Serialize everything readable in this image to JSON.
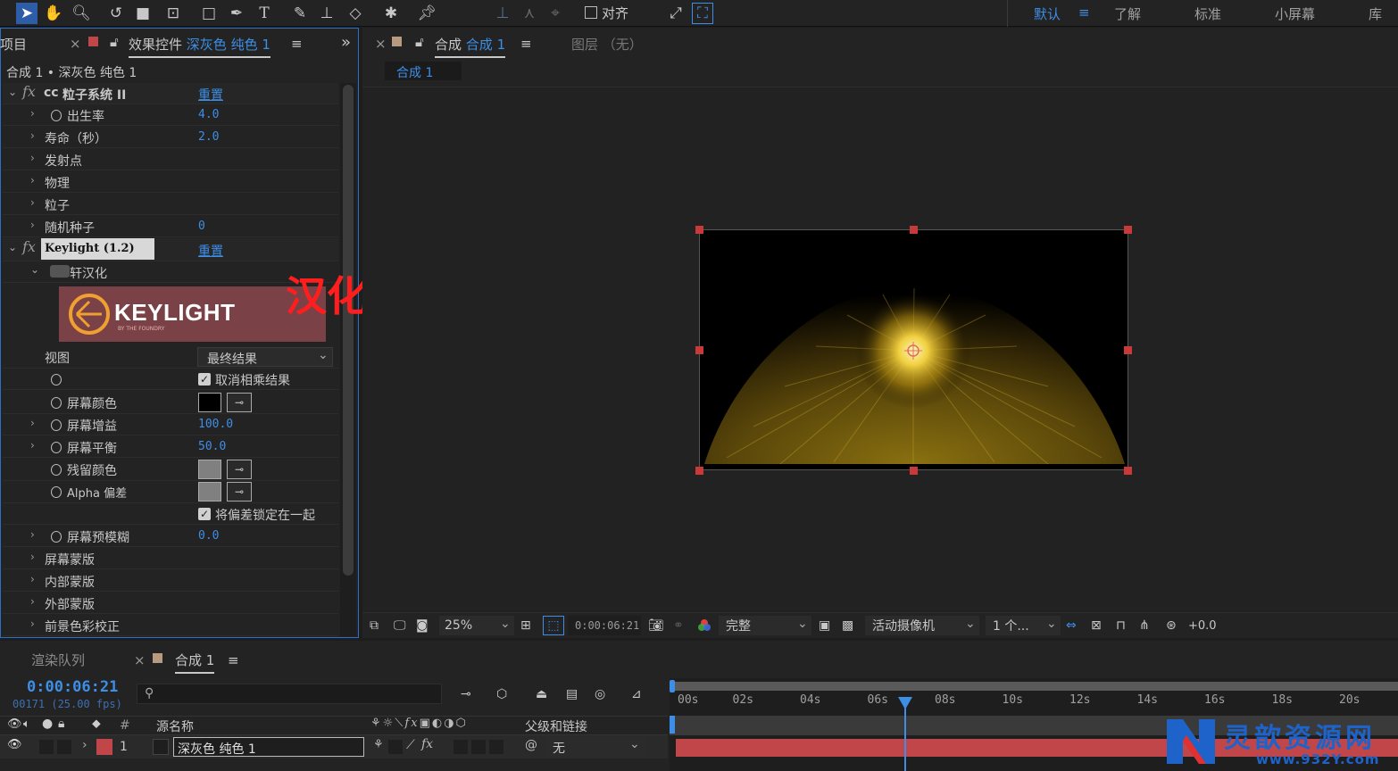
{
  "toolbar": {
    "align_label": "对齐",
    "workspaces": [
      "默认",
      "了解",
      "标准",
      "小屏幕",
      "库"
    ]
  },
  "effects_panel": {
    "project_tab": "项目",
    "tab_title": "效果控件",
    "tab_layer": "深灰色 纯色 1",
    "breadcrumb": "合成 1 • 深灰色 纯色 1",
    "effect1": {
      "name": "粒子系统 II",
      "reset": "重置"
    },
    "rows1": [
      {
        "label": "出生率",
        "value": "4.0"
      },
      {
        "label": "寿命（秒）",
        "value": "2.0"
      },
      {
        "label": "发射点",
        "value": ""
      },
      {
        "label": "物理",
        "value": ""
      },
      {
        "label": "粒子",
        "value": ""
      },
      {
        "label": "随机种子",
        "value": "0"
      }
    ],
    "effect2": {
      "name": "Keylight (1.2)",
      "reset": "重置"
    },
    "localized_group": "轩汉化",
    "logo_text": "KEYLIGHT",
    "logo_sub": "BY THE FOUNDRY",
    "overlay_text": "汉化后",
    "view_label": "视图",
    "view_value": "最终结果",
    "unpremultiply": "取消相乘结果",
    "screen_color": "屏幕颜色",
    "screen_gain": "屏幕增益",
    "screen_gain_value": "100.0",
    "screen_balance": "屏幕平衡",
    "screen_balance_value": "50.0",
    "despill_color": "残留颜色",
    "alpha_bias": "Alpha 偏差",
    "lock_biases": "将偏差锁定在一起",
    "screen_preblur": "屏幕预模糊",
    "screen_preblur_value": "0.0",
    "tail_groups": [
      "屏幕蒙版",
      "内部蒙版",
      "外部蒙版",
      "前景色彩校正"
    ]
  },
  "composition_panel": {
    "tab_prefix": "合成",
    "tab_name": "合成 1",
    "layer_tab": "图层 （无）",
    "flow_chip": "合成 1",
    "zoom": "25%",
    "timecode": "0:00:06:21",
    "resolution": "完整",
    "camera": "活动摄像机",
    "views": "1 个...",
    "exposure": "+0.0"
  },
  "timeline": {
    "render_queue_tab": "渲染队列",
    "comp_tab": "合成 1",
    "current_time": "0:00:06:21",
    "frame_info": "00171 (25.00 fps)",
    "col_source": "源名称",
    "col_parent": "父级和链接",
    "col_hash": "#",
    "layer_index": "1",
    "layer_name": "深灰色 纯色 1",
    "parent_value": "无",
    "ticks": [
      "00s",
      "02s",
      "04s",
      "06s",
      "08s",
      "10s",
      "12s",
      "14s",
      "16s",
      "18s",
      "20s"
    ],
    "playhead_seconds": 6.84
  },
  "watermark": {
    "title": "灵歆资源网",
    "url": "www.932Y.com"
  },
  "colors": {
    "accent": "#3e8ee6",
    "layer_red": "#c0464a",
    "handle": "#c83a3a",
    "particle": "#e8c43a"
  }
}
